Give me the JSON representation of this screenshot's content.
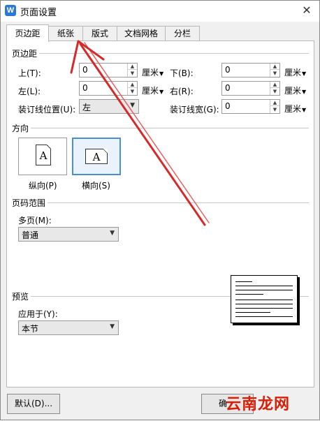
{
  "window": {
    "title": "页面设置",
    "app_icon_letter": "W",
    "close_glyph": "✕"
  },
  "tabs": [
    {
      "label": "页边距",
      "active": true
    },
    {
      "label": "纸张"
    },
    {
      "label": "版式"
    },
    {
      "label": "文档网格"
    },
    {
      "label": "分栏"
    }
  ],
  "margins": {
    "section_title": "页边距",
    "top": {
      "label": "上(T):",
      "value": "0",
      "unit": "厘米"
    },
    "bottom": {
      "label": "下(B):",
      "value": "0",
      "unit": "厘米"
    },
    "left": {
      "label": "左(L):",
      "value": "0",
      "unit": "厘米"
    },
    "right": {
      "label": "右(R):",
      "value": "0",
      "unit": "厘米"
    },
    "gutter_pos": {
      "label": "装订线位置(U):",
      "value": "左"
    },
    "gutter": {
      "label": "装订线宽(G):",
      "value": "0",
      "unit": "厘米"
    }
  },
  "orientation": {
    "section_title": "方向",
    "portrait": {
      "label": "纵向(P)",
      "glyph": "A"
    },
    "landscape": {
      "label": "横向(S)",
      "glyph": "A",
      "selected": true
    }
  },
  "pages": {
    "section_title": "页码范围",
    "multiple_label": "多页(M):",
    "multiple_value": "普通"
  },
  "preview": {
    "section_title": "预览",
    "apply_label": "应用于(Y):",
    "apply_value": "本节"
  },
  "buttons": {
    "default": "默认(D)...",
    "ok": "确"
  },
  "watermark": "云南龙网",
  "colors": {
    "annotation_arrow": "#d42a2a",
    "accent": "#4a8fd4"
  }
}
